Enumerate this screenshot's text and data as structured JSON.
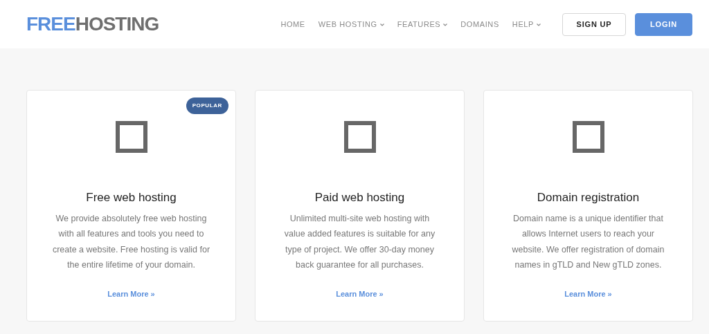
{
  "header": {
    "logo": {
      "accent": "FREE",
      "rest": "HOSTING"
    },
    "nav": [
      {
        "label": "HOME",
        "dropdown": false
      },
      {
        "label": "WEB HOSTING",
        "dropdown": true
      },
      {
        "label": "FEATURES",
        "dropdown": true
      },
      {
        "label": "DOMAINS",
        "dropdown": false
      },
      {
        "label": "HELP",
        "dropdown": true
      }
    ],
    "buttons": [
      {
        "label": "SIGN UP",
        "kind": "outline"
      },
      {
        "label": "LOGIN",
        "kind": "primary"
      }
    ]
  },
  "cards": [
    {
      "badge": "POPULAR",
      "title": "Free web hosting",
      "text": "We provide absolutely free web hosting with all features and tools you need to create a website. Free hosting is valid for the entire lifetime of your domain.",
      "link": "Learn More »"
    },
    {
      "title": "Paid web hosting",
      "text": "Unlimited multi-site web hosting with value added features is suitable for any type of project. We offer 30-day money back guarantee for all purchases.",
      "link": "Learn More »"
    },
    {
      "title": "Domain registration",
      "text": "Domain name is a unique identifier that allows Internet users to reach your website. We offer registration of domain names in gTLD and New gTLD zones.",
      "link": "Learn More »"
    }
  ]
}
